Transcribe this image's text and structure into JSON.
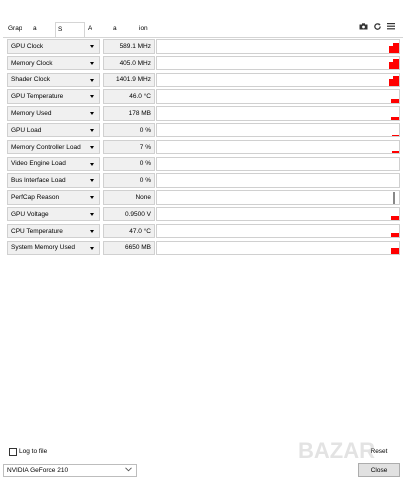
{
  "tabs": [
    {
      "label": "Grap",
      "active": false
    },
    {
      "label": "a",
      "active": false
    },
    {
      "label": "S",
      "active": true
    },
    {
      "label": "A",
      "active": false
    },
    {
      "label": "a",
      "active": false
    },
    {
      "label": "ion",
      "active": false
    }
  ],
  "top_icons": [
    "camera-icon",
    "refresh-icon",
    "menu-icon"
  ],
  "sensors": [
    {
      "name": "GPU Clock",
      "value": "589.1 MHz",
      "graph": "red-steps",
      "level": 0.55
    },
    {
      "name": "Memory Clock",
      "value": "405.0 MHz",
      "graph": "red-steps",
      "level": 0.6
    },
    {
      "name": "Shader Clock",
      "value": "1401.9 MHz",
      "graph": "red-steps",
      "level": 0.6
    },
    {
      "name": "GPU Temperature",
      "value": "46.0 °C",
      "graph": "red-flat",
      "level": 0.3
    },
    {
      "name": "Memory Used",
      "value": "178 MB",
      "graph": "red-flat",
      "level": 0.2
    },
    {
      "name": "GPU Load",
      "value": "0 %",
      "graph": "red-spike",
      "level": 0.08
    },
    {
      "name": "Memory Controller Load",
      "value": "7 %",
      "graph": "red-spike",
      "level": 0.15
    },
    {
      "name": "Video Engine Load",
      "value": "0 %",
      "graph": "none",
      "level": 0
    },
    {
      "name": "Bus Interface Load",
      "value": "0 %",
      "graph": "none",
      "level": 0
    },
    {
      "name": "PerfCap Reason",
      "value": "None",
      "graph": "gray-bar",
      "level": 0.9
    },
    {
      "name": "GPU Voltage",
      "value": "0.9500 V",
      "graph": "red-flat",
      "level": 0.35
    },
    {
      "name": "CPU Temperature",
      "value": "47.0 °C",
      "graph": "red-flat",
      "level": 0.35
    },
    {
      "name": "System Memory Used",
      "value": "6650 MB",
      "graph": "red-flat",
      "level": 0.45
    }
  ],
  "footer": {
    "log_label": "Log to file",
    "reset_label": "Reset",
    "gpu_selected": "NVIDIA GeForce 210",
    "close_label": "Close"
  },
  "colors": {
    "graph_red": "#ff0000",
    "border": "#d0d0d0",
    "field_bg": "#f0f0f0"
  }
}
